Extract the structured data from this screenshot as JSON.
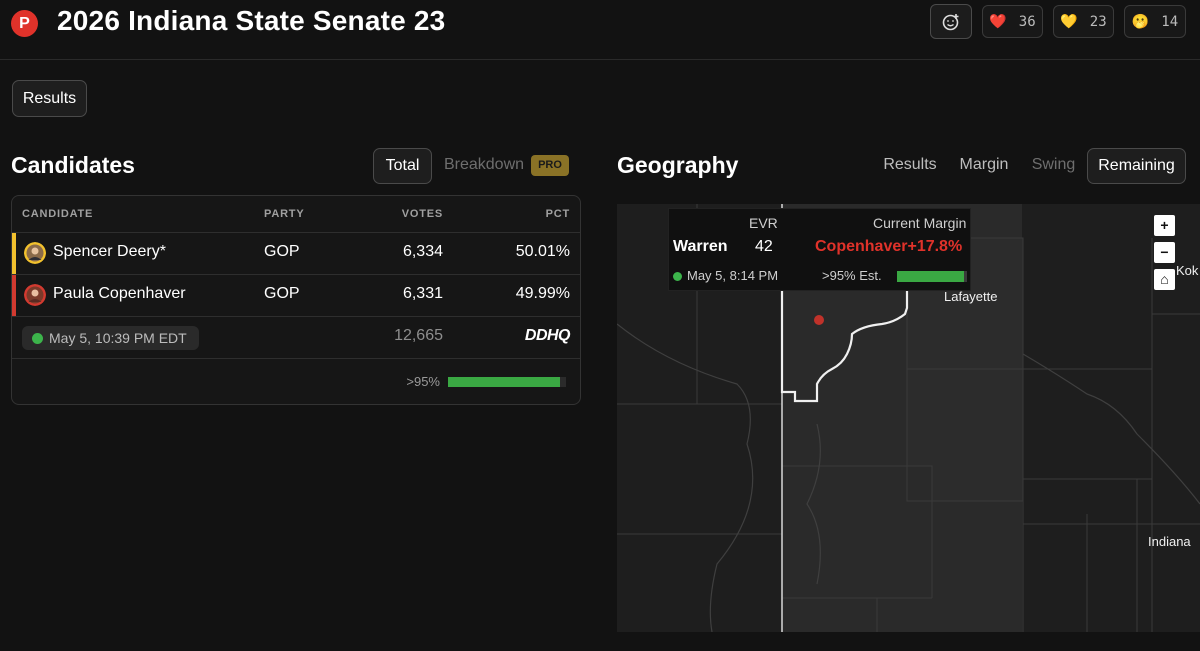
{
  "header": {
    "logo_letter": "P",
    "title": "2026 Indiana State Senate 23",
    "reactions": [
      {
        "icon": "red-heart",
        "emoji": "❤️",
        "count": "36"
      },
      {
        "icon": "yellow-heart",
        "emoji": "💛",
        "count": "23"
      },
      {
        "icon": "face-with-hand-over-mouth",
        "emoji": "🫢",
        "count": "14"
      }
    ]
  },
  "results_tab": "Results",
  "candidates": {
    "title": "Candidates",
    "tabs": {
      "total": "Total",
      "breakdown": "Breakdown",
      "pro": "PRO"
    },
    "columns": {
      "candidate": "CANDIDATE",
      "party": "PARTY",
      "votes": "VOTES",
      "pct": "PCT"
    },
    "rows": [
      {
        "name": "Spencer Deery*",
        "party": "GOP",
        "votes": "6,334",
        "pct": "50.01%",
        "color": "#f2c12e"
      },
      {
        "name": "Paula Copenhaver",
        "party": "GOP",
        "votes": "6,331",
        "pct": "49.99%",
        "color": "#d23a30"
      }
    ],
    "updated": "May 5, 10:39 PM EDT",
    "total_votes": "12,665",
    "source": "DDHQ",
    "reporting_label": ">95%",
    "reporting_fraction": 0.95
  },
  "geography": {
    "title": "Geography",
    "tabs": {
      "results": "Results",
      "margin": "Margin",
      "swing": "Swing",
      "remaining": "Remaining"
    },
    "tooltip": {
      "col_evr": "EVR",
      "col_margin": "Current Margin",
      "county": "Warren",
      "evr": "42",
      "margin": "Copenhaver+17.8%",
      "margin_color": "#e0322a",
      "time": "May 5, 8:14 PM",
      "estimate": ">95% Est.",
      "estimate_fraction": 0.95
    },
    "labels": {
      "lafayette": "Lafayette",
      "indianapolis": "Indiana",
      "kokomo": "Kok"
    },
    "controls": {
      "zoom_in": "+",
      "zoom_out": "−",
      "home": "⌂"
    }
  }
}
